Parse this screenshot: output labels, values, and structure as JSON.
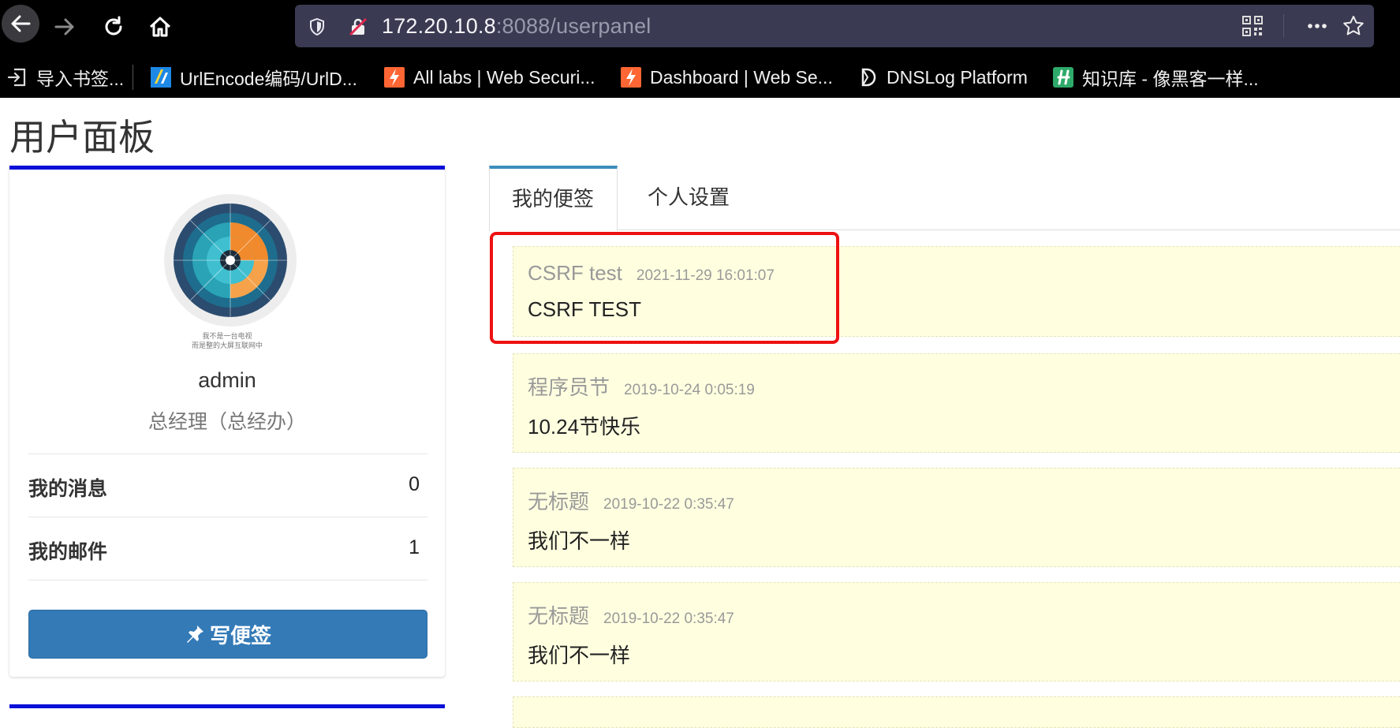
{
  "browser": {
    "url_host": "172.20.10.8",
    "url_path": ":8088/userpanel",
    "bookmarks": [
      {
        "label": "导入书签...",
        "icon": "import-icon"
      },
      {
        "label": "UrlEncode编码/UrlD...",
        "icon": "site-favicon"
      },
      {
        "label": "All labs | Web Securi...",
        "icon": "portswigger-favicon"
      },
      {
        "label": "Dashboard | Web Se...",
        "icon": "portswigger-favicon"
      },
      {
        "label": "DNSLog Platform",
        "icon": "dnslog-favicon"
      },
      {
        "label": "知识库 - 像黑客一样...",
        "icon": "h-favicon"
      }
    ]
  },
  "page": {
    "title": "用户面板"
  },
  "profile": {
    "avatar_caption_1": "我不是一台电视",
    "avatar_caption_2": "而是整的大屏互联网中",
    "username": "admin",
    "role": "总经理（总经办）",
    "stats": [
      {
        "label": "我的消息",
        "value": "0"
      },
      {
        "label": "我的邮件",
        "value": "1"
      }
    ],
    "write_button": "写便签"
  },
  "tabs": [
    {
      "label": "我的便签",
      "active": true
    },
    {
      "label": "个人设置",
      "active": false
    }
  ],
  "notes": [
    {
      "title": "CSRF test",
      "time": "2021-11-29 16:01:07",
      "body": "CSRF TEST"
    },
    {
      "title": "程序员节",
      "time": "2019-10-24 0:05:19",
      "body": "10.24节快乐"
    },
    {
      "title": "无标题",
      "time": "2019-10-22 0:35:47",
      "body": "我们不一样"
    },
    {
      "title": "无标题",
      "time": "2019-10-22 0:35:47",
      "body": "我们不一样"
    }
  ],
  "colors": {
    "card_accent": "#0a10d8",
    "primary_button": "#337ab7",
    "tab_accent": "#3c8dbc",
    "note_bg": "#ffffe0",
    "highlight": "#ee1111"
  }
}
